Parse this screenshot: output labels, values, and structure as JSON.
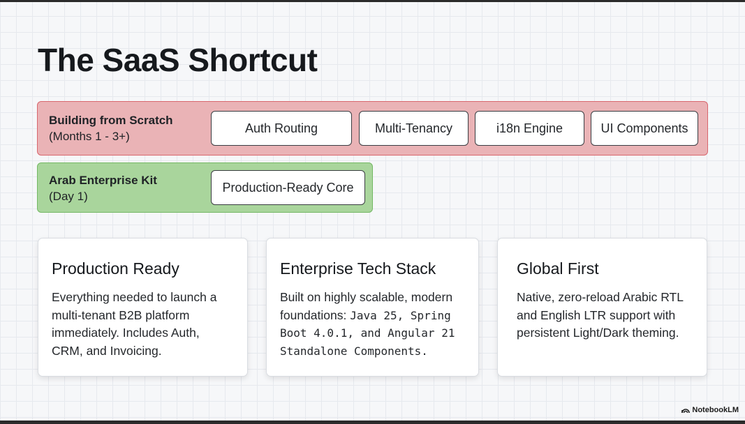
{
  "slide": {
    "title": "The SaaS Shortcut"
  },
  "comparison": {
    "scratch": {
      "title": "Building from Scratch",
      "subtitle": "(Months 1 - 3+)",
      "chips": [
        "Auth Routing",
        "Multi-Tenancy",
        "i18n Engine",
        "UI Components"
      ]
    },
    "kit": {
      "title": "Arab Enterprise Kit",
      "subtitle": "(Day 1)",
      "chips": [
        "Production-Ready Core"
      ]
    }
  },
  "cards": [
    {
      "title": "Production Ready",
      "body": "Everything needed to launch a multi-tenant B2B platform immediately. Includes Auth, CRM, and Invoicing."
    },
    {
      "title": "Enterprise Tech Stack",
      "body_prefix": "Built on highly scalable, modern foundations: ",
      "body_mono": "Java 25, Spring Boot 4.0.1, and Angular 21 Standalone Components."
    },
    {
      "title": "Global First",
      "body": "Native, zero-reload Arabic RTL and English LTR support with persistent Light/Dark theming."
    }
  ],
  "watermark": {
    "label": "NotebookLM",
    "icon": "notebooklm-logo-icon"
  },
  "colors": {
    "scratch_fill": "#eab3b6",
    "scratch_border": "#d8666d",
    "kit_fill": "#a9d59c",
    "kit_border": "#74b864"
  }
}
